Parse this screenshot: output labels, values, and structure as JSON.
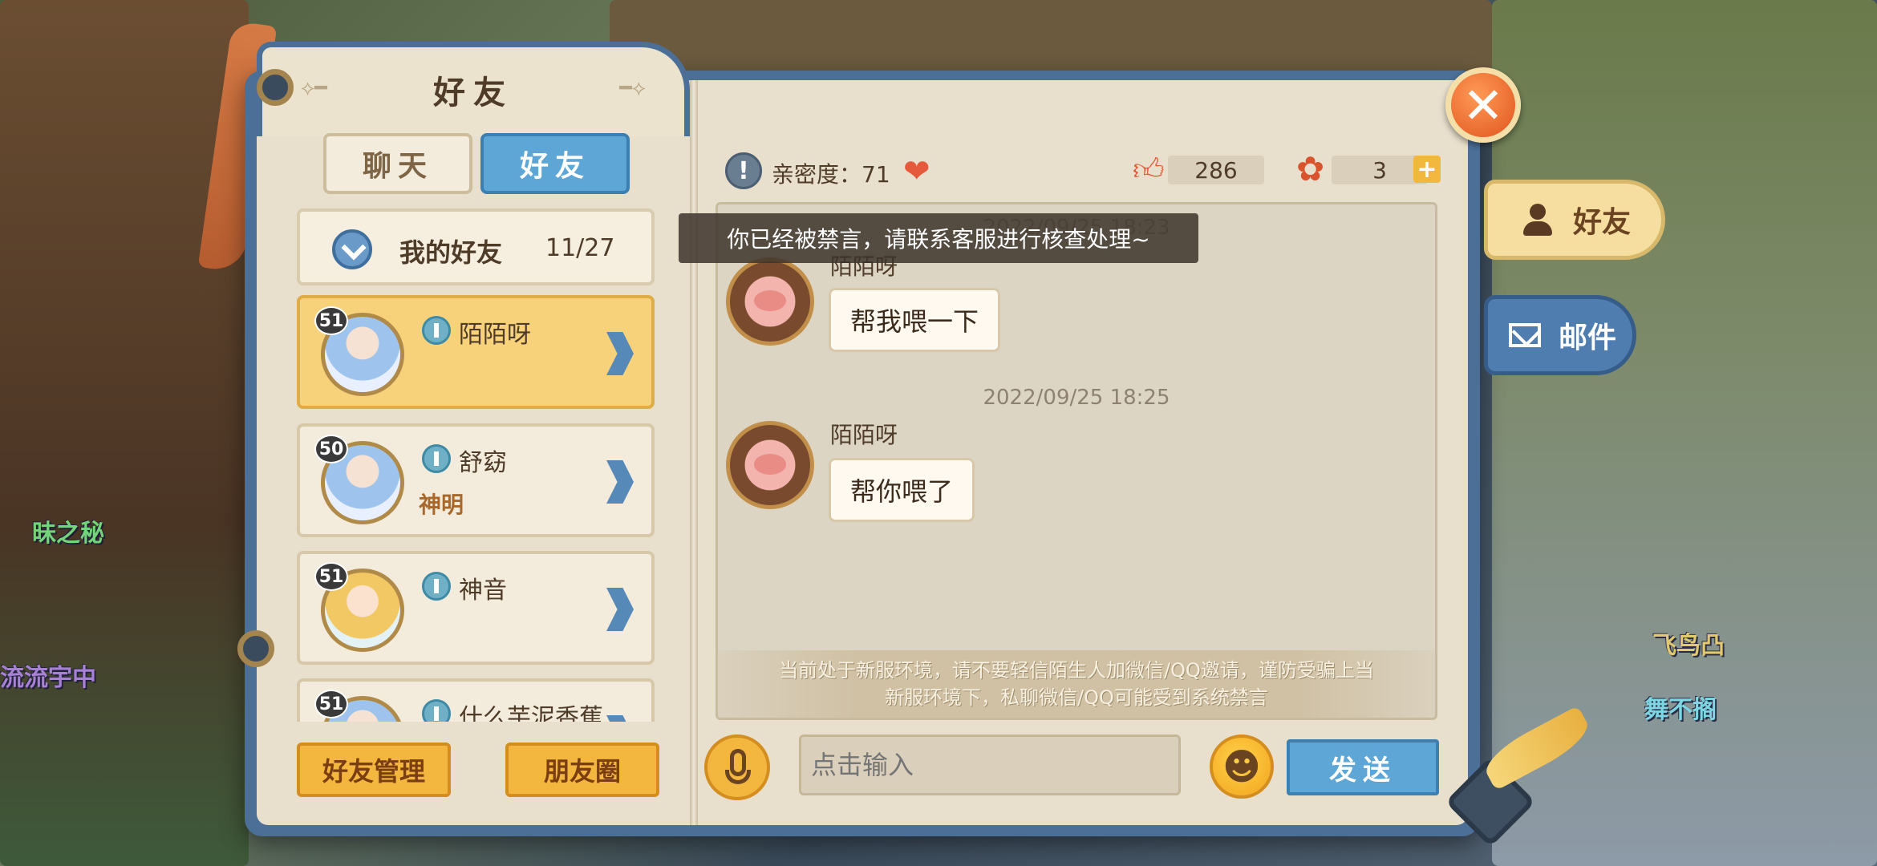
{
  "background": {
    "names": [
      "飞鸟凸",
      "舞不搁",
      "昧之秘",
      "流流宇中"
    ]
  },
  "panel": {
    "title": "好友"
  },
  "tabs": {
    "chat": "聊天",
    "friends": "好友"
  },
  "side_tabs": {
    "friends": "好友",
    "mail": "邮件"
  },
  "group": {
    "label": "我的好友",
    "count": "11/27"
  },
  "friends": [
    {
      "level": "51",
      "name": "陌陌呀",
      "title": "",
      "selected": true
    },
    {
      "level": "50",
      "name": "舒窈",
      "title": "神明",
      "selected": false
    },
    {
      "level": "51",
      "name": "神音",
      "title": "",
      "selected": false
    },
    {
      "level": "51",
      "name": "什么芋泥香蕉",
      "title": "",
      "selected": false
    }
  ],
  "buttons": {
    "manage": "好友管理",
    "moments": "朋友圈",
    "send": "发送"
  },
  "stats": {
    "intimacy_label": "亲密度：71",
    "likes": "286",
    "roses": "3"
  },
  "toast": "你已经被禁言，请联系客服进行核查处理~",
  "chat": {
    "partial_time": "2022/09/25 18:23",
    "messages": [
      {
        "sender": "陌陌呀",
        "text": "帮我喂一下",
        "time": ""
      },
      {
        "sender": "陌陌呀",
        "text": "帮你喂了",
        "time": "2022/09/25 18:25"
      }
    ],
    "notice_line1": "当前处于新服环境，请不要轻信陌生人加微信/QQ邀请，谨防受骗上当",
    "notice_line2": "新服环境下，私聊微信/QQ可能受到系统禁言"
  },
  "input": {
    "placeholder": "点击输入"
  },
  "colors": {
    "frame_blue": "#4b6f97",
    "parchment": "#e8dfcd",
    "active_card": "#f7d27a",
    "send_blue": "#5da6d6",
    "orange_button": "#f3b63e"
  },
  "icons": {
    "close": "close-icon",
    "person": "person-icon",
    "mail": "mail-icon",
    "chevron": "chevron-down-icon",
    "heart": "heart-icon",
    "thumbs_up": "thumbs-up-icon",
    "rose": "rose-icon",
    "plus": "plus-icon",
    "microphone": "microphone-icon",
    "emoji": "emoji-icon"
  }
}
